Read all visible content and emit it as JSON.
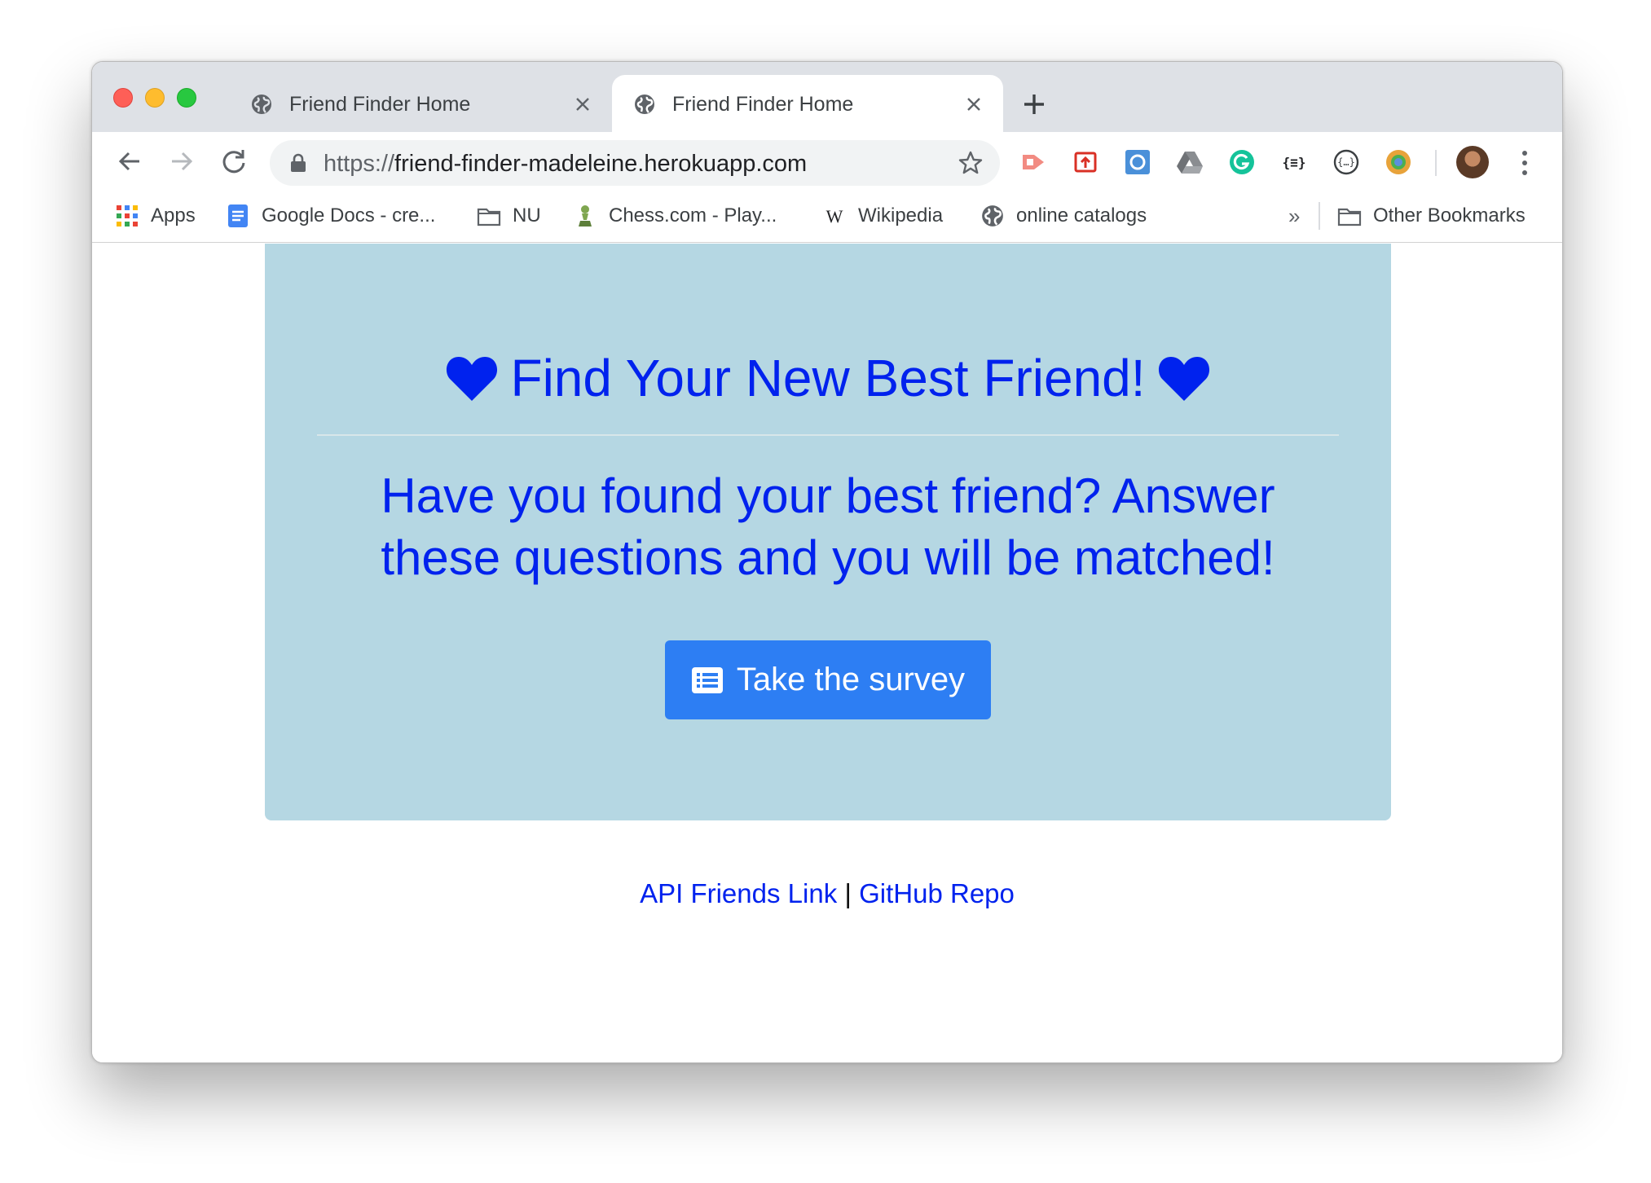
{
  "browser": {
    "tabs": [
      {
        "title": "Friend Finder Home",
        "active": false
      },
      {
        "title": "Friend Finder Home",
        "active": true
      }
    ],
    "address": {
      "scheme": "https://",
      "host": "friend-finder-madeleine.herokuapp.com"
    },
    "bookmarks": [
      {
        "label": "Apps",
        "icon": "apps-grid-icon"
      },
      {
        "label": "Google Docs - cre...",
        "icon": "google-docs-icon"
      },
      {
        "label": "NU",
        "icon": "folder-icon"
      },
      {
        "label": "Chess.com - Play...",
        "icon": "chess-pawn-icon"
      },
      {
        "label": "Wikipedia",
        "icon": "wikipedia-icon"
      },
      {
        "label": "online catalogs",
        "icon": "globe-icon"
      }
    ],
    "bookmarks_overflow": "»",
    "other_bookmarks": "Other Bookmarks",
    "extensions": [
      "video-extension-icon",
      "save-extension-icon",
      "screenshot-extension-icon",
      "drive-icon",
      "grammarly-icon",
      "json-formatter-icon",
      "api-extension-icon",
      "chrome-color-icon"
    ]
  },
  "page": {
    "headline": "Find Your New Best Friend!",
    "lead": "Have you found your best friend? Answer these questions and you will be matched!",
    "survey_button": "Take the survey",
    "footer": {
      "api_link": "API Friends Link",
      "separator": "|",
      "repo_link": "GitHub Repo"
    }
  },
  "colors": {
    "jumbotron_bg": "#b5d7e3",
    "headline_text": "#0022ee",
    "button_bg": "#2d7ef3",
    "tabstrip_bg": "#dee1e6"
  }
}
